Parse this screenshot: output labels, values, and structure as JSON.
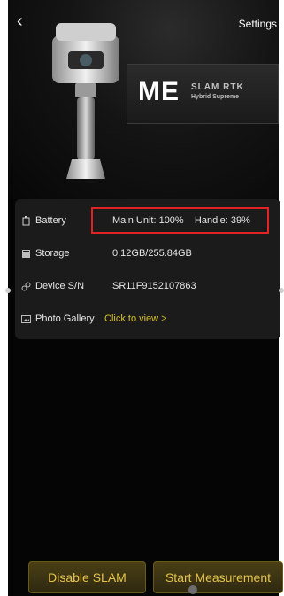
{
  "header": {
    "back_icon": "chevron-left-icon",
    "settings_label": "Settings"
  },
  "brand": {
    "logo_text": "ME",
    "line1": "SLAM RTK",
    "line2": "Hybrid Supreme"
  },
  "info": {
    "rows": [
      {
        "icon": "battery-icon",
        "label": "Battery",
        "value": "Main Unit: 100%    Handle: 39%"
      },
      {
        "icon": "storage-icon",
        "label": "Storage",
        "value": "0.12GB/255.84GB"
      },
      {
        "icon": "link-icon",
        "label": "Device S/N",
        "value": "SR11F9152107863"
      },
      {
        "icon": "image-icon",
        "label": "Photo Gallery",
        "value": "Click to view >"
      }
    ]
  },
  "buttons": {
    "disable_slam": "Disable SLAM",
    "start_measurement": "Start Measurement"
  }
}
